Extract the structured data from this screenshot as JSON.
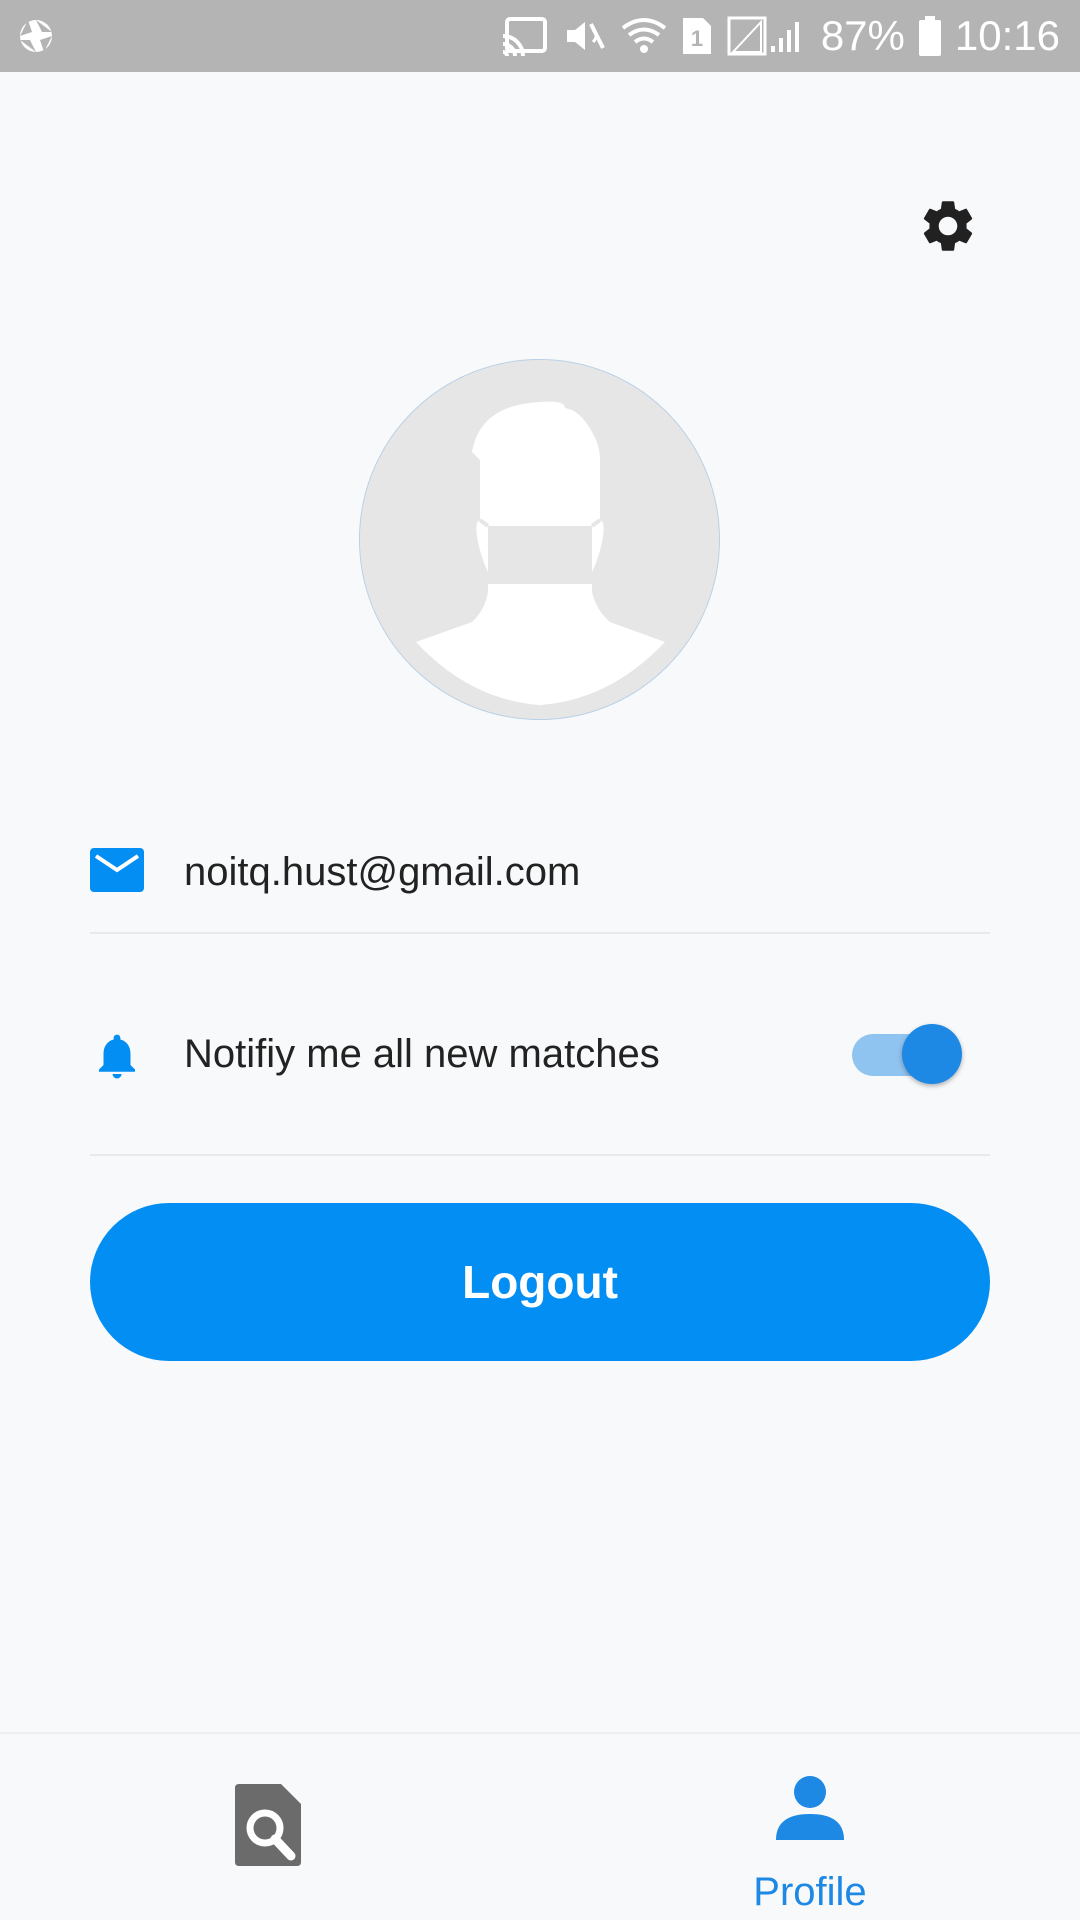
{
  "status_bar": {
    "battery_percent": "87%",
    "time": "10:16",
    "sim_badge": "1",
    "icons": [
      "camera-aperture-icon",
      "cast-icon",
      "mute-icon",
      "wifi-icon",
      "sim-icon",
      "signal-icon",
      "battery-icon"
    ]
  },
  "header": {
    "settings_icon": "gear-icon"
  },
  "profile": {
    "avatar": "masked-person-placeholder"
  },
  "account": {
    "email_icon": "mail-icon",
    "email": "noitq.hust@gmail.com"
  },
  "notifications": {
    "icon": "bell-icon",
    "label": "Notifiy me all new matches",
    "enabled": true
  },
  "actions": {
    "logout_label": "Logout"
  },
  "bottom_nav": {
    "items": [
      {
        "icon": "search-document-icon",
        "label": "",
        "active": false
      },
      {
        "icon": "person-icon",
        "label": "Profile",
        "active": true
      }
    ]
  },
  "colors": {
    "accent": "#038ef3",
    "active_nav": "#1e88e5",
    "status_bar": "#b4b4b4",
    "background": "#f8f9fa"
  }
}
